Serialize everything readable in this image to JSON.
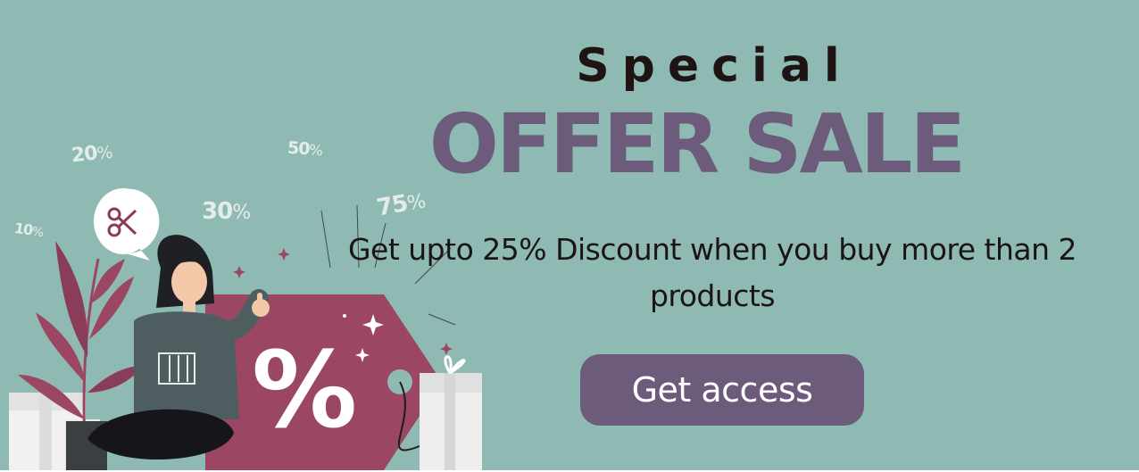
{
  "hero": {
    "title_line1": "Special",
    "title_line2": "OFFER SALE",
    "description": "Get upto 25% Discount when you buy more than 2 products",
    "cta_label": "Get access"
  },
  "illustration": {
    "floating_percentages": [
      {
        "number": "20",
        "sign": "%"
      },
      {
        "number": "50",
        "sign": "%"
      },
      {
        "number": "30",
        "sign": "%"
      },
      {
        "number": "75",
        "sign": "%"
      },
      {
        "number": "10",
        "sign": "%"
      }
    ],
    "tag_symbol": "%",
    "icons": [
      "scissors-icon",
      "price-tag-icon",
      "gift-box-icon",
      "plant-icon",
      "sparkle-icon"
    ]
  },
  "colors": {
    "background": "#8fbab3",
    "accent_purple": "#6c5b7b",
    "tag_magenta": "#9b4763",
    "text_dark": "#1a1414"
  }
}
